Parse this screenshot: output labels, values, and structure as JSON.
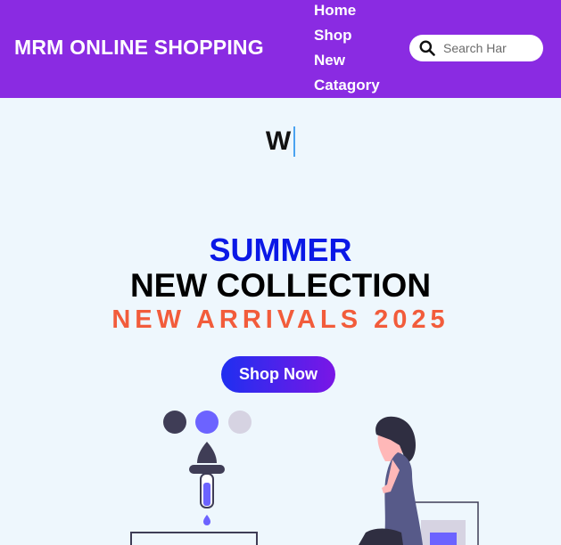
{
  "header": {
    "brand": "MRM ONLINE SHOPPING",
    "nav": [
      {
        "label": "Home"
      },
      {
        "label": "Shop"
      },
      {
        "label": "New"
      },
      {
        "label": "Catagory"
      }
    ],
    "search": {
      "placeholder": "Search Har",
      "icon": "search-icon"
    }
  },
  "hero": {
    "typed_text": "W",
    "line1": "SUMMER",
    "line2": "NEW COLLECTION",
    "line3": "NEW ARRIVALS 2025",
    "cta_label": "Shop Now"
  },
  "colors": {
    "header_bg": "#8a2be2",
    "page_bg": "#eef7fd",
    "summer": "#0a18e6",
    "arrivals": "#f25c3b",
    "accent": "#6c63ff"
  }
}
